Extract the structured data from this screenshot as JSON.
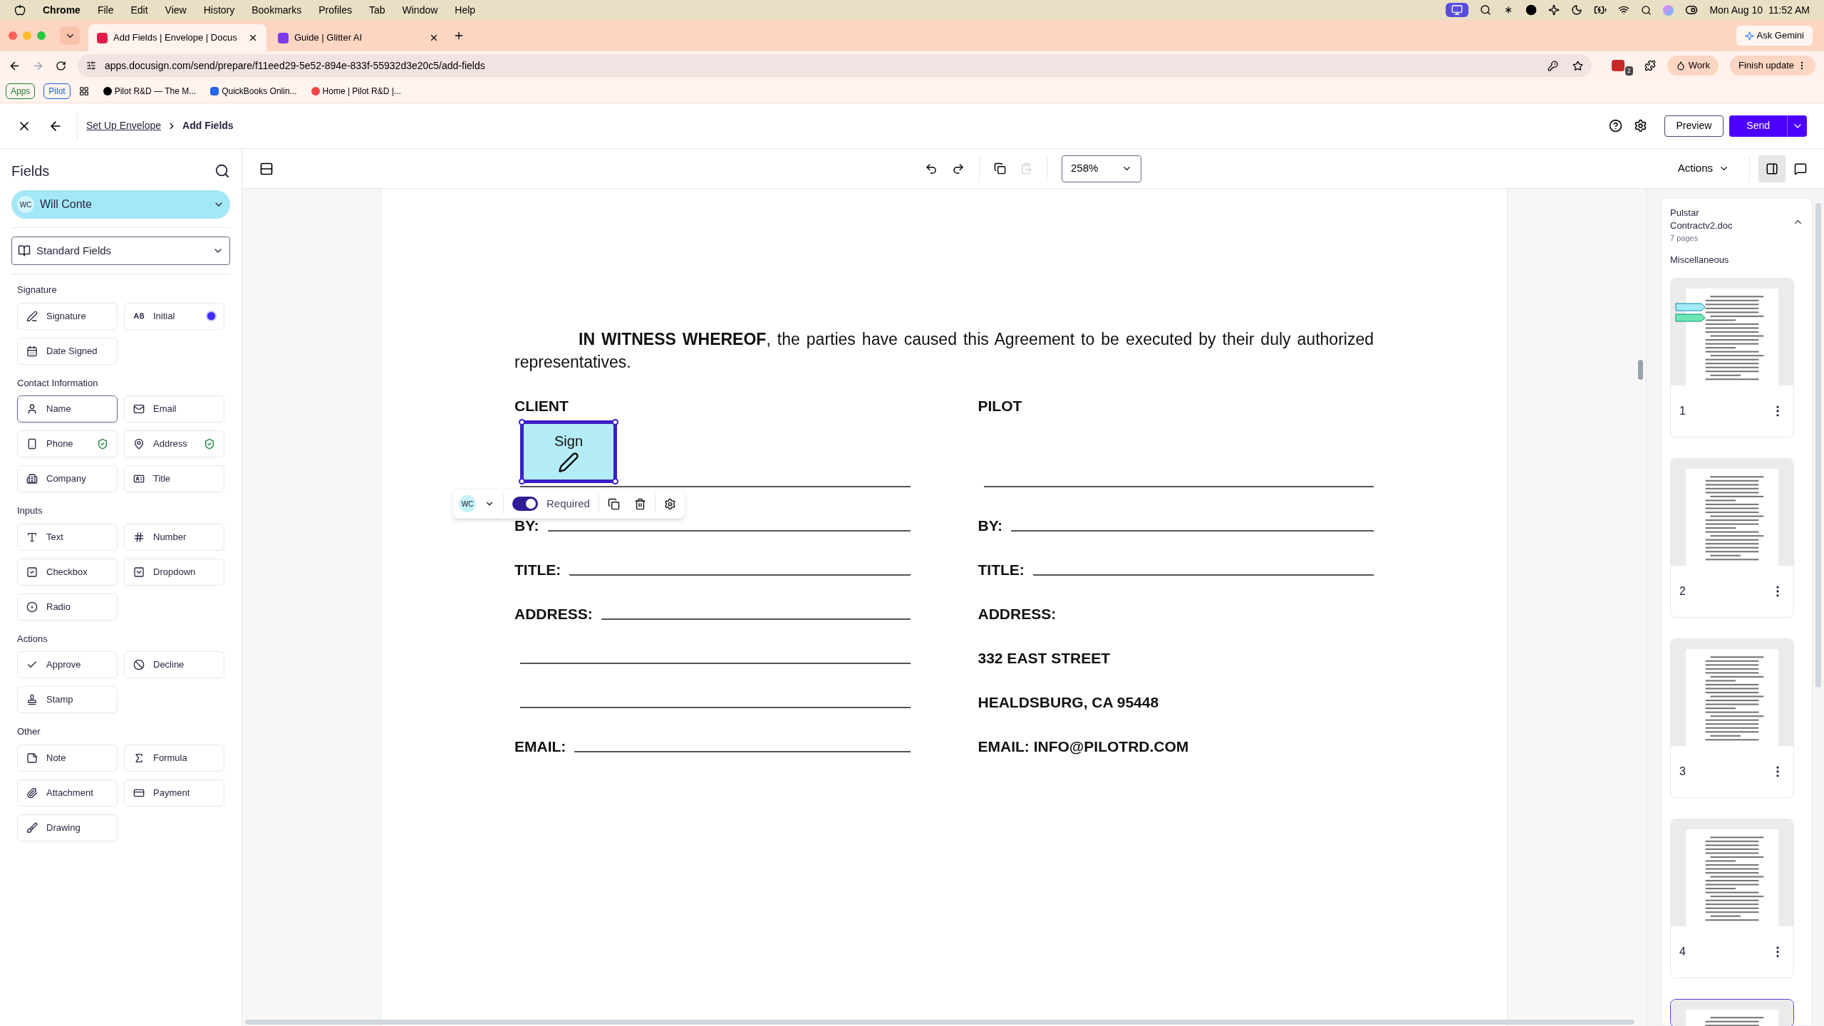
{
  "menubar": {
    "app": "Chrome",
    "menus": [
      "File",
      "Edit",
      "View",
      "History",
      "Bookmarks",
      "Profiles",
      "Tab",
      "Window",
      "Help"
    ],
    "clock": "Mon Aug 10  11:52 AM"
  },
  "browser": {
    "tabs": [
      {
        "title": "Add Fields | Envelope | Docus",
        "selected": true
      },
      {
        "title": "Guide | Glitter AI",
        "selected": false
      }
    ],
    "ask": "Ask Gemini",
    "url": "apps.docusign.com/send/prepare/f11eed29-5e52-894e-833f-55932d3e20c5/add-fields",
    "extension_badge": "2",
    "profile": "Work",
    "update": "Finish update",
    "tab_groups": [
      {
        "label": "Apps",
        "color": "#1e7b34"
      },
      {
        "label": "Pilot",
        "color": "#1a5fd1"
      }
    ],
    "bookmarks": [
      "Pilot R&D — The M...",
      "QuickBooks Onlin...",
      "Home | Pilot R&D |..."
    ]
  },
  "header": {
    "breadcrumb_link": "Set Up Envelope",
    "breadcrumb_current": "Add Fields",
    "preview": "Preview",
    "send": "Send"
  },
  "toolbar": {
    "zoom": "258%",
    "actions": "Actions"
  },
  "sidebar": {
    "title": "Fields",
    "recipient": {
      "initials": "WC",
      "name": "Will Conte"
    },
    "library": "Standard Fields",
    "sections": [
      {
        "title": "Signature",
        "fields": [
          {
            "label": "Signature",
            "kind": "signature",
            "verified": false,
            "dot": false,
            "hovered": false
          },
          {
            "label": "Initial",
            "kind": "initial",
            "verified": false,
            "dot": true,
            "hovered": false
          },
          {
            "label": "Date Signed",
            "kind": "date",
            "verified": false,
            "dot": false,
            "hovered": false
          }
        ]
      },
      {
        "title": "Contact Information",
        "fields": [
          {
            "label": "Name",
            "kind": "name",
            "verified": false,
            "dot": false,
            "hovered": true
          },
          {
            "label": "Email",
            "kind": "email",
            "verified": false,
            "dot": false,
            "hovered": false
          },
          {
            "label": "Phone",
            "kind": "phone",
            "verified": true,
            "dot": false,
            "hovered": false
          },
          {
            "label": "Address",
            "kind": "address",
            "verified": true,
            "dot": false,
            "hovered": false
          },
          {
            "label": "Company",
            "kind": "company",
            "verified": false,
            "dot": false,
            "hovered": false
          },
          {
            "label": "Title",
            "kind": "title",
            "verified": false,
            "dot": false,
            "hovered": false
          }
        ]
      },
      {
        "title": "Inputs",
        "fields": [
          {
            "label": "Text",
            "kind": "text",
            "verified": false,
            "dot": false,
            "hovered": false
          },
          {
            "label": "Number",
            "kind": "number",
            "verified": false,
            "dot": false,
            "hovered": false
          },
          {
            "label": "Checkbox",
            "kind": "checkbox",
            "verified": false,
            "dot": false,
            "hovered": false
          },
          {
            "label": "Dropdown",
            "kind": "dropdown",
            "verified": false,
            "dot": false,
            "hovered": false
          },
          {
            "label": "Radio",
            "kind": "radio",
            "verified": false,
            "dot": false,
            "hovered": false
          }
        ]
      },
      {
        "title": "Actions",
        "fields": [
          {
            "label": "Approve",
            "kind": "approve",
            "verified": false,
            "dot": false,
            "hovered": false
          },
          {
            "label": "Decline",
            "kind": "decline",
            "verified": false,
            "dot": false,
            "hovered": false
          },
          {
            "label": "Stamp",
            "kind": "stamp",
            "verified": false,
            "dot": false,
            "hovered": false
          }
        ]
      },
      {
        "title": "Other",
        "fields": [
          {
            "label": "Note",
            "kind": "note",
            "verified": false,
            "dot": false,
            "hovered": false
          },
          {
            "label": "Formula",
            "kind": "formula",
            "verified": false,
            "dot": false,
            "hovered": false
          },
          {
            "label": "Attachment",
            "kind": "attachment",
            "verified": false,
            "dot": false,
            "hovered": false
          },
          {
            "label": "Payment",
            "kind": "payment",
            "verified": false,
            "dot": false,
            "hovered": false
          },
          {
            "label": "Drawing",
            "kind": "drawing",
            "verified": false,
            "dot": false,
            "hovered": false
          }
        ]
      }
    ]
  },
  "document": {
    "paragraph": "**IN WITNESS WHEREOF**, the parties have caused this Agreement to be executed by their duly authorized representatives.",
    "columns": [
      {
        "heading": "CLIENT",
        "rows": [
          {
            "kind": "line"
          },
          {
            "kind": "line",
            "label": "BY:"
          },
          {
            "kind": "line",
            "label": "TITLE:"
          },
          {
            "kind": "line",
            "label": "ADDRESS:"
          },
          {
            "kind": "line"
          },
          {
            "kind": "line"
          },
          {
            "kind": "line",
            "label": "EMAIL:"
          }
        ]
      },
      {
        "heading": "PILOT",
        "rows": [
          {
            "kind": "line"
          },
          {
            "kind": "line",
            "label": "BY:"
          },
          {
            "kind": "line",
            "label": "TITLE:"
          },
          {
            "kind": "text",
            "text": "ADDRESS:"
          },
          {
            "kind": "text",
            "text": "332 EAST STREET"
          },
          {
            "kind": "text",
            "text": "HEALDSBURG, CA 95448"
          },
          {
            "kind": "text",
            "text": "EMAIL: INFO@PILOTRD.COM"
          }
        ]
      }
    ],
    "sign_field": {
      "label": "Sign",
      "initials": "WC",
      "required": true,
      "required_label": "Required"
    }
  },
  "pages_panel": {
    "document": "Pulstar Contractv2.doc",
    "pages": "7 pages",
    "group": "Miscellaneous",
    "thumbnails": [
      {
        "number": "1",
        "tagged": true,
        "selected": false
      },
      {
        "number": "2",
        "tagged": false,
        "selected": false
      },
      {
        "number": "3",
        "tagged": false,
        "selected": false
      },
      {
        "number": "4",
        "tagged": false,
        "selected": false
      },
      {
        "tagged": false,
        "selected": true
      }
    ]
  }
}
